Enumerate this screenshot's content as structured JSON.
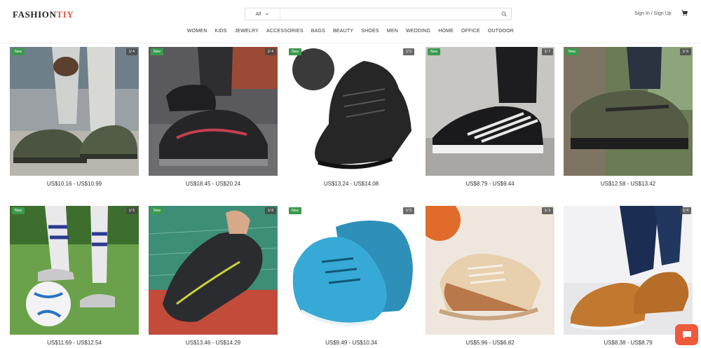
{
  "brand": {
    "part1": "FASHION",
    "part2": "TIY"
  },
  "search": {
    "category": "All",
    "placeholder": ""
  },
  "account": {
    "sign_in": "Sign In",
    "separator": "/",
    "sign_up": "Sign Up"
  },
  "nav": [
    "WOMEN",
    "KIDS",
    "JEWELRY",
    "ACCESSORIES",
    "BAGS",
    "BEAUTY",
    "SHOES",
    "MEN",
    "WEDDING",
    "HOME",
    "OFFICE",
    "OUTDOOR"
  ],
  "products": [
    {
      "new": "New",
      "count": "1/ 4",
      "price": "US$10.16 - US$10.99"
    },
    {
      "new": "New",
      "count": "1/ 4",
      "price": "US$18.45 - US$20.24"
    },
    {
      "new": "New",
      "count": "1/ 5",
      "price": "US$13.24 - US$14.08"
    },
    {
      "new": "New",
      "count": "1/ 7",
      "price": "US$8.79 - US$9.44"
    },
    {
      "new": "New",
      "count": "1/ 6",
      "price": "US$12.58 - US$13.42"
    },
    {
      "new": "New",
      "count": "1/ 5",
      "price": "US$11.69 - US$12.54"
    },
    {
      "new": "New",
      "count": "1/ 8",
      "price": "US$13.46 - US$14.29"
    },
    {
      "new": "New",
      "count": "1/ 5",
      "price": "US$9.49 - US$10.34"
    },
    {
      "new": "",
      "count": "1/ 3",
      "price": "US$5.96 - US$6.82"
    },
    {
      "new": "",
      "count": "1/ 4",
      "price": "US$8.38 - US$8.79"
    }
  ],
  "colors": {
    "accent": "#e0533d",
    "new_badge": "#3a9a4c",
    "chat": "#ee5a3c"
  }
}
